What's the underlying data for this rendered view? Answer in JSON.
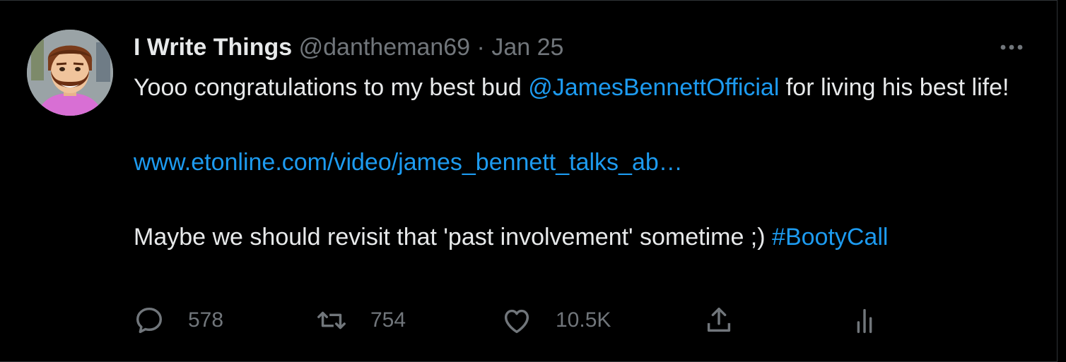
{
  "tweet": {
    "author": {
      "display_name": "I Write Things",
      "handle": "@dantheman69",
      "avatar_icon": "bearded-man-avatar"
    },
    "separator": "·",
    "date": "Jan 25",
    "text": {
      "line1_prefix": "Yooo congratulations to my best bud ",
      "mention": "@JamesBennettOfficial",
      "line1_suffix": " for living his best life!",
      "url": "www.etonline.com/video/james_bennett_talks_ab…",
      "line3_prefix": "Maybe we should revisit that 'past involvement' sometime ;) ",
      "hashtag": "#BootyCall"
    },
    "actions": {
      "replies": "578",
      "retweets": "754",
      "likes": "10.5K"
    }
  },
  "colors": {
    "background": "#000000",
    "text": "#e7e9ea",
    "muted": "#71767b",
    "link": "#1d9bf0",
    "border": "#2f3336"
  },
  "icons": [
    "more-icon",
    "reply-icon",
    "retweet-icon",
    "like-icon",
    "share-icon",
    "analytics-icon"
  ]
}
